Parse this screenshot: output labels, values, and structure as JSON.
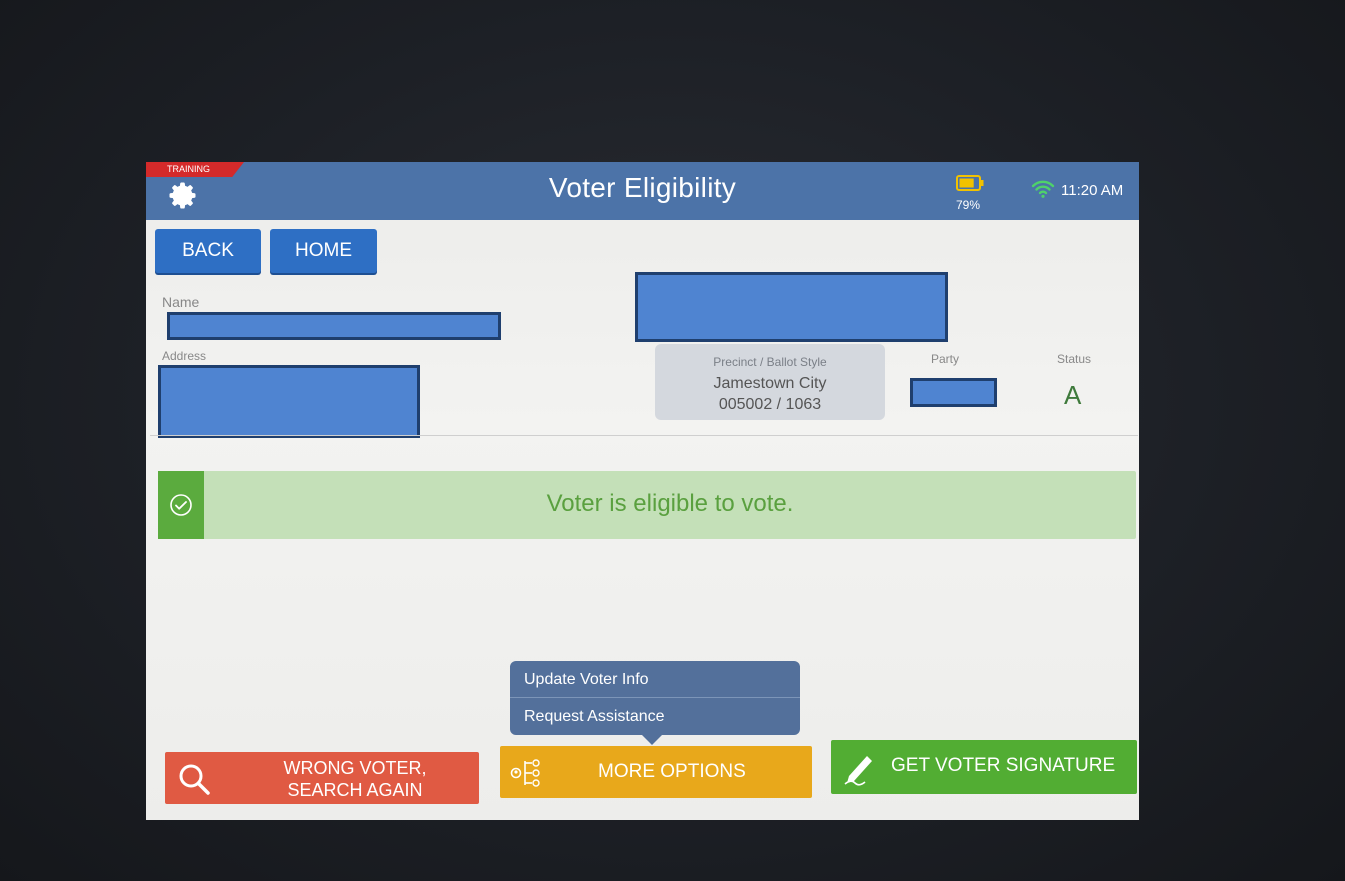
{
  "header": {
    "training_label": "TRAINING",
    "title": "Voter Eligibility",
    "battery_percent": "79%",
    "battery_level": 0.79,
    "time": "11:20 AM"
  },
  "nav": {
    "back_label": "BACK",
    "home_label": "HOME"
  },
  "voter": {
    "name_label": "Name",
    "address_label": "Address",
    "precinct_label": "Precinct / Ballot Style",
    "precinct_name": "Jamestown City",
    "precinct_code": "005002 / 1063",
    "party_label": "Party",
    "status_label": "Status",
    "status_value": "A"
  },
  "eligibility": {
    "message": "Voter is eligible to vote."
  },
  "more_options_menu": {
    "items": [
      "Update Voter Info",
      "Request Assistance"
    ]
  },
  "actions": {
    "wrong_voter_line1": "WRONG VOTER,",
    "wrong_voter_line2": "SEARCH AGAIN",
    "more_options": "MORE OPTIONS",
    "get_signature": "GET VOTER SIGNATURE"
  },
  "colors": {
    "header_bg": "#4c73a8",
    "nav_button": "#2e6fc4",
    "eligible_bg": "#c4e0b8",
    "eligible_accent": "#5bab3e",
    "wrong_voter": "#e05a43",
    "more_options": "#e8a81b",
    "get_signature": "#52ad33",
    "redaction": "#4f84d1"
  },
  "icons": {
    "settings": "gear-icon",
    "battery": "battery-icon",
    "wifi": "wifi-icon",
    "eligible": "check-circle-icon",
    "search": "search-icon",
    "options": "options-tree-icon",
    "signature": "pen-icon"
  }
}
